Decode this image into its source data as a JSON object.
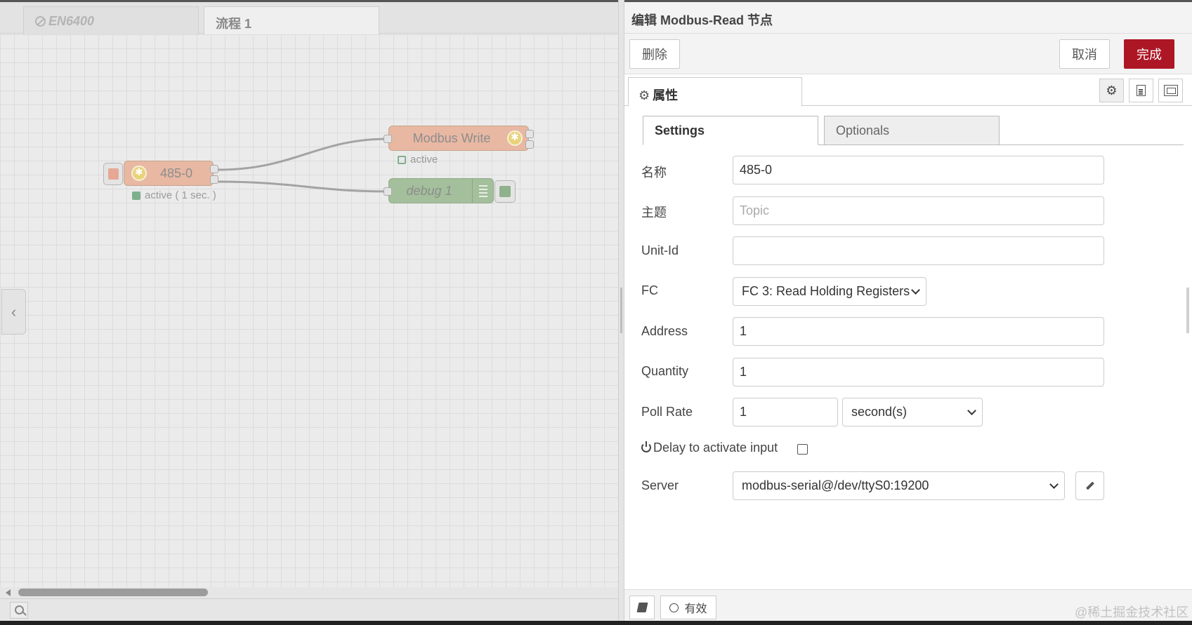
{
  "workspace": {
    "tabs": [
      {
        "label": "EN6400",
        "disabled": true
      },
      {
        "label": "流程 1",
        "disabled": false
      }
    ],
    "nodes": {
      "read": {
        "label": "485-0",
        "status": "active ( 1 sec. )"
      },
      "write": {
        "label": "Modbus Write",
        "status": "active"
      },
      "debug": {
        "label": "debug 1"
      }
    }
  },
  "editor": {
    "title": "编辑 Modbus-Read 节点",
    "buttons": {
      "delete": "删除",
      "cancel": "取消",
      "done": "完成"
    },
    "tab_properties": "属性",
    "sub_tabs": {
      "settings": "Settings",
      "optionals": "Optionals"
    },
    "fields": {
      "name": {
        "label": "名称",
        "value": "485-0"
      },
      "topic": {
        "label": "主题",
        "placeholder": "Topic",
        "value": ""
      },
      "unit_id": {
        "label": "Unit-Id",
        "value": ""
      },
      "fc": {
        "label": "FC",
        "value": "FC 3: Read Holding Registers"
      },
      "address": {
        "label": "Address",
        "value": "1"
      },
      "quantity": {
        "label": "Quantity",
        "value": "1"
      },
      "poll_rate": {
        "label": "Poll Rate",
        "value": "1",
        "unit": "second(s)"
      },
      "delay": {
        "label": "Delay to activate input",
        "checked": false
      },
      "server": {
        "label": "Server",
        "value": "modbus-serial@/dev/ttyS0:19200"
      }
    },
    "footer": {
      "enabled_label": "有效"
    },
    "watermark": "@稀土掘金技术社区"
  },
  "colors": {
    "done_button": "#ad1625",
    "modbus_node": "#e8b8a3",
    "debug_node": "#a3bf9b",
    "status_green": "#7fb08e"
  }
}
